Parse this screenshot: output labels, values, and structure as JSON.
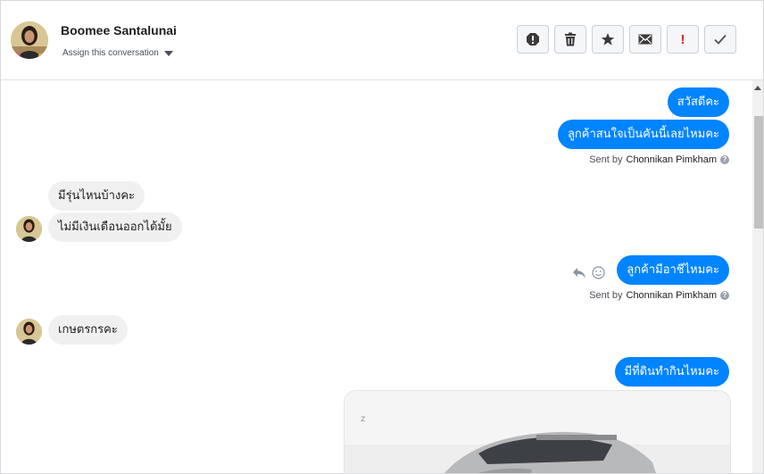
{
  "header": {
    "contact_name": "Boomee Santalunai",
    "assign_label": "Assign this conversation",
    "toolbar": {
      "spam": "spam-alert-icon",
      "delete": "trash-icon",
      "star": "star-icon",
      "mail": "envelope-icon",
      "important": "!",
      "done": "checkmark-icon"
    },
    "important_color": "#e02020"
  },
  "messages": {
    "m1": "สวัสดีคะ",
    "m2": "ลูกค้าสนใจเป็นคันนี้เลยไหมคะ",
    "sent1_prefix": "Sent by",
    "sent1_agent": "Chonnikan Pimkham",
    "m3": "มีรุ่นไหนบ้างคะ",
    "m4": "ไม่มีเงินเดือนออกได้มั้ย",
    "m5": "ลูกค้ามีอาชีไหมคะ",
    "sent2_prefix": "Sent by",
    "sent2_agent": "Chonnikan Pimkham",
    "m6": "เกษตรกรคะ",
    "m7": "มีที่ดินทำกินไหมคะ",
    "help_glyph": "?"
  },
  "colors": {
    "outgoing": "#0084ff",
    "incoming": "#f1f0f0"
  }
}
